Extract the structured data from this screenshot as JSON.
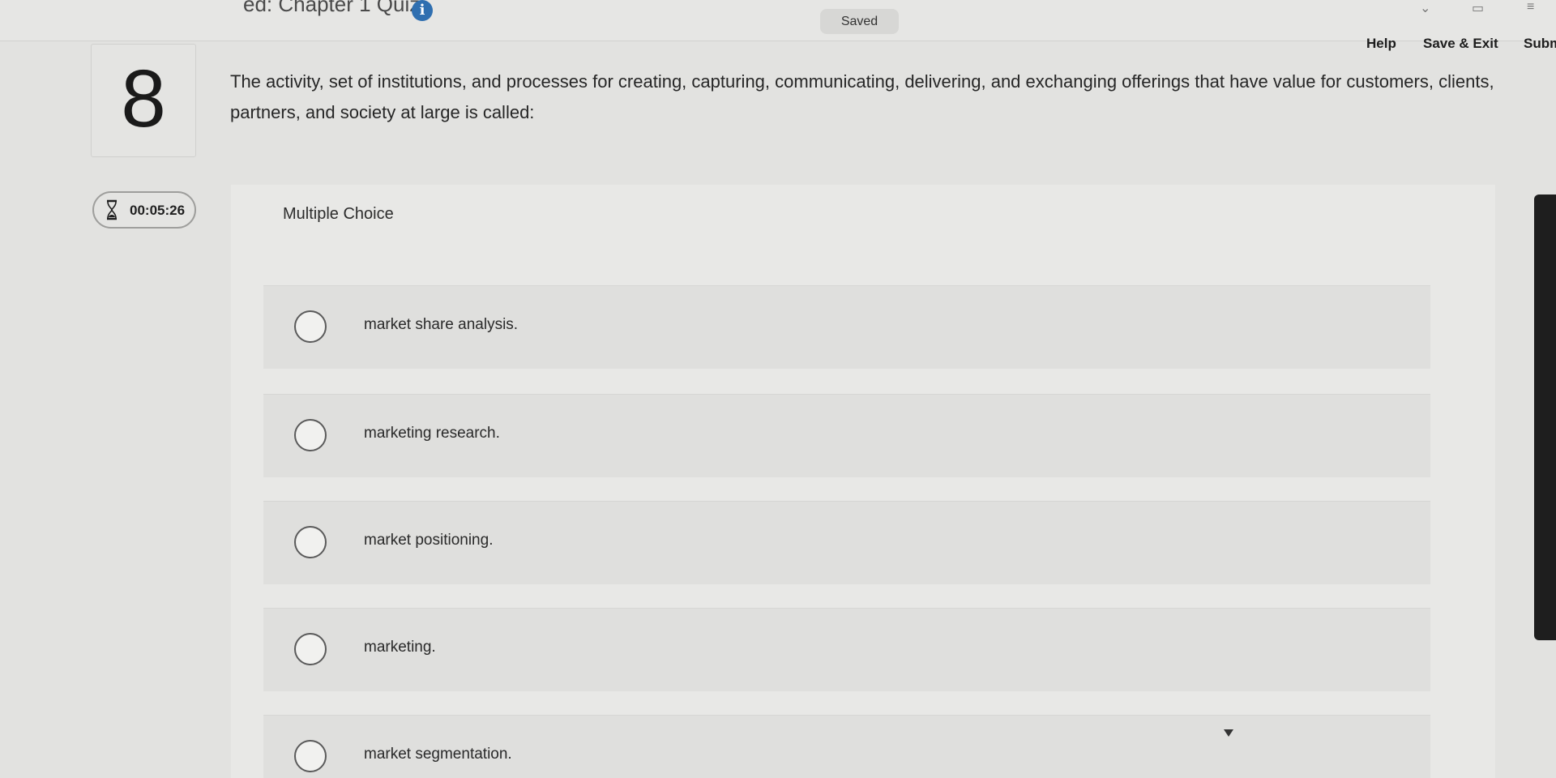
{
  "header": {
    "quiz_title": "ed: Chapter 1 Quiz",
    "info_icon": "i",
    "saved_label": "Saved",
    "help_label": "Help",
    "save_exit_label": "Save & Exit",
    "submit_label": "Subm"
  },
  "question": {
    "number": "8",
    "text": "The activity, set of institutions, and processes for creating, capturing, communicating, delivering, and exchanging offerings that have value for customers, clients, partners, and society at large is called:",
    "type_label": "Multiple Choice"
  },
  "timer": {
    "value": "00:05:26",
    "icon": "hourglass-icon"
  },
  "choices": [
    {
      "label": "market share analysis."
    },
    {
      "label": "marketing research."
    },
    {
      "label": "market positioning."
    },
    {
      "label": "marketing."
    },
    {
      "label": "market segmentation."
    }
  ],
  "colors": {
    "background": "#e2e2e0",
    "info_icon": "#2f6fb0",
    "text": "#262626"
  }
}
